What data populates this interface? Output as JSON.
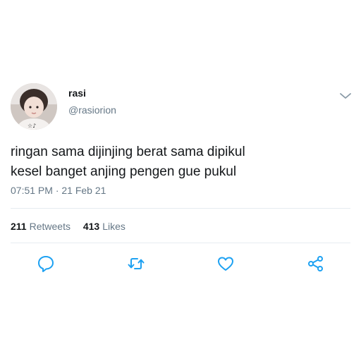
{
  "user": {
    "name": "rasi",
    "handle": "@rasiorion"
  },
  "tweet": {
    "lines": [
      "ringan sama dijinjing berat sama dipikul",
      "kesel banget anjing pengen gue pukul"
    ],
    "timestamp": "07:51 PM · 21 Feb 21"
  },
  "stats": {
    "retweets_count": "211",
    "retweets_label": "Retweets",
    "likes_count": "413",
    "likes_label": "Likes"
  },
  "icons": {
    "caret": "chevron-down-icon",
    "reply": "reply-icon",
    "retweet": "retweet-icon",
    "like": "heart-icon",
    "share": "share-icon"
  },
  "colors": {
    "text_primary": "#14171a",
    "text_secondary": "#657786",
    "icon_accent": "#1da1f2",
    "divider": "#e6ecf0"
  }
}
